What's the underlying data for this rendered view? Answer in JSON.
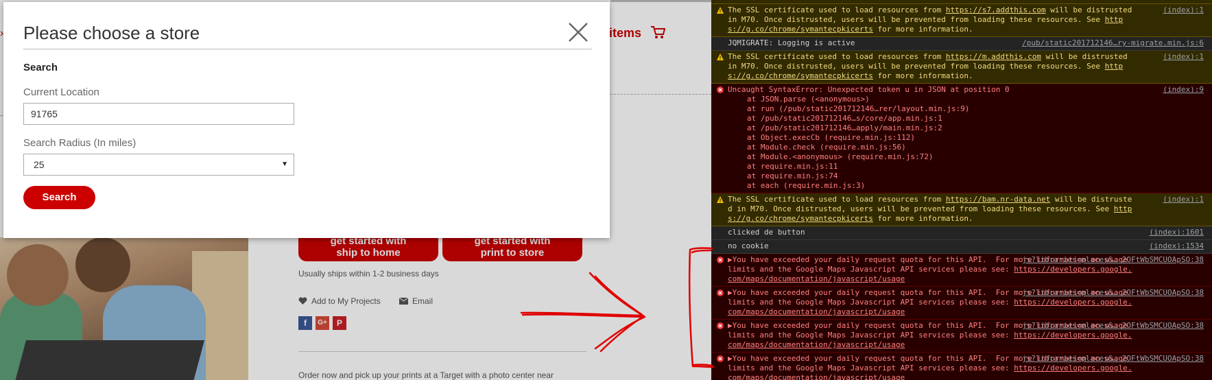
{
  "site": {
    "items_label": "items",
    "cta_ship": [
      "get started with",
      "ship to home"
    ],
    "cta_print": [
      "get started with",
      "print to store"
    ],
    "ships_text": "Usually ships within 1-2 business days",
    "add_projects": "Add to My Projects",
    "email": "Email",
    "social": {
      "fb": "f",
      "gp": "G+",
      "pin": "P"
    },
    "order_text": "Order now and pick up your prints at a Target with a photo center near",
    "brand_color": "#cc0000"
  },
  "modal": {
    "title": "Please choose a store",
    "search_heading": "Search",
    "location_label": "Current Location",
    "location_value": "91765",
    "radius_label": "Search Radius (In miles)",
    "radius_value": "25",
    "search_button": "Search"
  },
  "console": {
    "messages": [
      {
        "type": "warn",
        "text": "The SSL certificate used to load resources from ",
        "link": "https://s7.addthis.com",
        "tail": " will be distrusted in M70. Once distrusted, users will be prevented from loading these resources. See ",
        "link2": "https://g.co/chrome/symantecpkicerts",
        "tail2": " for more information.",
        "src": "(index):1"
      },
      {
        "type": "info",
        "text": "JQMIGRATE: Logging is active",
        "src": "/pub/static201712146…ry-migrate.min.js:6"
      },
      {
        "type": "warn",
        "text": "The SSL certificate used to load resources from ",
        "link": "https://m.addthis.com",
        "tail": " will be distrusted in M70. Once distrusted, users will be prevented from loading these resources. See ",
        "link2": "https://g.co/chrome/symantecpkicerts",
        "tail2": " for more information.",
        "src": "(index):1"
      },
      {
        "type": "err",
        "text": "Uncaught SyntaxError: Unexpected token u in JSON at position 0",
        "src": "(index):9",
        "stack": [
          "at JSON.parse (<anonymous>)",
          "at run (/pub/static201712146…rer/layout.min.js:9)",
          "at /pub/static201712146…s/core/app.min.js:1",
          "at /pub/static201712146…apply/main.min.js:2",
          "at Object.execCb (require.min.js:112)",
          "at Module.check (require.min.js:56)",
          "at Module.<anonymous> (require.min.js:72)",
          "at require.min.js:11",
          "at require.min.js:74",
          "at each (require.min.js:3)"
        ]
      },
      {
        "type": "warn",
        "text": "The SSL certificate used to load resources from ",
        "link": "https://bam.nr-data.net",
        "tail": " will be distrusted in M70. Once distrusted, users will be prevented from loading these resources. See ",
        "link2": "https://g.co/chrome/symantecpkicerts",
        "tail2": " for more information.",
        "src": "(index):1"
      },
      {
        "type": "info",
        "text": "clicked de button",
        "src": "(index):1601"
      },
      {
        "type": "info",
        "text": "no cookie",
        "src": "(index):1534"
      },
      {
        "type": "err",
        "text": "▶You have exceeded your daily request quota for this API.  For more information on usage limits and the Google Maps Javascript API services please see: ",
        "link": "https://developers.google.com/maps/documentation/javascript/usage",
        "src": "js?libraries=places&… 2OFtWbSMCUOApSO:38"
      },
      {
        "type": "err",
        "text": "▶You have exceeded your daily request quota for this API.  For more information on usage limits and the Google Maps Javascript API services please see: ",
        "link": "https://developers.google.com/maps/documentation/javascript/usage",
        "src": "js?libraries=places&… 2OFtWbSMCUOApSO:38"
      },
      {
        "type": "err",
        "text": "▶You have exceeded your daily request quota for this API.  For more information on usage limits and the Google Maps Javascript API services please see: ",
        "link": "https://developers.google.com/maps/documentation/javascript/usage",
        "src": "js?libraries=places&… 2OFtWbSMCUOApSO:38"
      },
      {
        "type": "err",
        "text": "▶You have exceeded your daily request quota for this API.  For more information on usage limits and the Google Maps Javascript API services please see: ",
        "link": "https://developers.google.com/maps/documentation/javascript/usage",
        "src": "js?libraries=places&… 2OFtWbSMCUOApSO:38"
      }
    ]
  },
  "colors": {
    "warn_bg": "#332b00",
    "err_bg": "#290000",
    "annotation": "#e00000"
  }
}
